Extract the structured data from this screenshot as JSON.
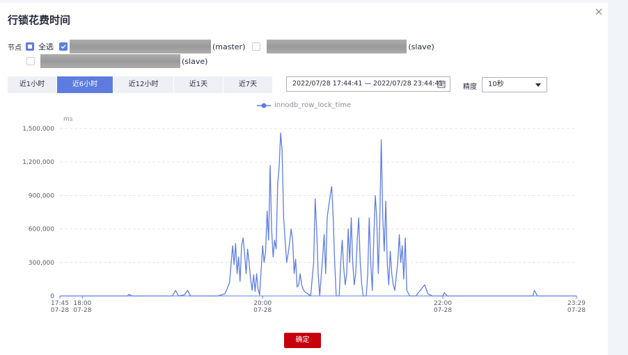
{
  "dialog": {
    "title": "行锁花费时间",
    "close_icon": "close-icon"
  },
  "nodes": {
    "label": "节点",
    "select_all": "全选",
    "items": [
      {
        "role": "(master)",
        "checked": true
      },
      {
        "role": "(slave)",
        "checked": false
      },
      {
        "role": "(slave)",
        "checked": false
      }
    ]
  },
  "time_tabs": [
    {
      "label": "近1小时",
      "active": false
    },
    {
      "label": "近6小时",
      "active": true
    },
    {
      "label": "近12小时",
      "active": false
    },
    {
      "label": "近1天",
      "active": false
    },
    {
      "label": "近7天",
      "active": false
    }
  ],
  "date_range": {
    "value": "2022/07/28 17:44:41 — 2022/07/28 23:44:41",
    "icon": "calendar-icon"
  },
  "precision": {
    "label": "精度",
    "value": "10秒"
  },
  "colors": {
    "accent": "#5e7ce0",
    "confirm": "#c7000b",
    "series": "#5e7ce0"
  },
  "chart_data": {
    "type": "line",
    "ylabel": "ms",
    "ylim": [
      0,
      1500000
    ],
    "yticks": [
      "0",
      "300,000",
      "600,000",
      "900,000",
      "1,200,000",
      "1,500,000"
    ],
    "grid": true,
    "legend_position": "top-center",
    "xticks": [
      {
        "time": "17:45",
        "date": "07-28"
      },
      {
        "time": "18:00",
        "date": "07-28"
      },
      {
        "time": "20:00",
        "date": "07-28"
      },
      {
        "time": "22:00",
        "date": "07-28"
      },
      {
        "time": "23:29",
        "date": "07-28"
      }
    ],
    "series": [
      {
        "name": "innodb_row_lock_time",
        "points": [
          [
            "17:45",
            0
          ],
          [
            "18:15",
            0
          ],
          [
            "18:30",
            0
          ],
          [
            "18:31",
            15000
          ],
          [
            "18:33",
            0
          ],
          [
            "19:00",
            0
          ],
          [
            "19:02",
            50000
          ],
          [
            "19:04",
            0
          ],
          [
            "19:08",
            10000
          ],
          [
            "19:10",
            50000
          ],
          [
            "19:12",
            0
          ],
          [
            "19:30",
            0
          ],
          [
            "19:35",
            20000
          ],
          [
            "19:38",
            120000
          ],
          [
            "19:40",
            450000
          ],
          [
            "19:41",
            280000
          ],
          [
            "19:42",
            470000
          ],
          [
            "19:43",
            200000
          ],
          [
            "19:44",
            350000
          ],
          [
            "19:45",
            130000
          ],
          [
            "19:46",
            450000
          ],
          [
            "19:47",
            520000
          ],
          [
            "19:48",
            380000
          ],
          [
            "19:49",
            200000
          ],
          [
            "19:50",
            420000
          ],
          [
            "19:51",
            300000
          ],
          [
            "19:52",
            150000
          ],
          [
            "19:53",
            50000
          ],
          [
            "19:54",
            190000
          ],
          [
            "19:55",
            40000
          ],
          [
            "19:56",
            200000
          ],
          [
            "19:57",
            60000
          ],
          [
            "19:58",
            10000
          ],
          [
            "20:00",
            450000
          ],
          [
            "20:01",
            300000
          ],
          [
            "20:02",
            400000
          ],
          [
            "20:03",
            760000
          ],
          [
            "20:04",
            500000
          ],
          [
            "20:05",
            1170000
          ],
          [
            "20:06",
            600000
          ],
          [
            "20:07",
            350000
          ],
          [
            "20:08",
            500000
          ],
          [
            "20:09",
            420000
          ],
          [
            "20:10",
            1000000
          ],
          [
            "20:11",
            1150000
          ],
          [
            "20:12",
            1460000
          ],
          [
            "20:13",
            1300000
          ],
          [
            "20:14",
            700000
          ],
          [
            "20:15",
            500000
          ],
          [
            "20:16",
            300000
          ],
          [
            "20:17",
            380000
          ],
          [
            "20:18",
            480000
          ],
          [
            "20:19",
            600000
          ],
          [
            "20:20",
            500000
          ],
          [
            "20:21",
            200000
          ],
          [
            "20:22",
            330000
          ],
          [
            "20:23",
            80000
          ],
          [
            "20:24",
            100000
          ],
          [
            "20:25",
            200000
          ],
          [
            "20:26",
            100000
          ],
          [
            "20:27",
            60000
          ],
          [
            "20:28",
            40000
          ],
          [
            "20:30",
            20000
          ],
          [
            "20:32",
            0
          ],
          [
            "20:34",
            300000
          ],
          [
            "20:35",
            870000
          ],
          [
            "20:36",
            600000
          ],
          [
            "20:37",
            200000
          ],
          [
            "20:38",
            0
          ],
          [
            "20:40",
            350000
          ],
          [
            "20:41",
            550000
          ],
          [
            "20:42",
            200000
          ],
          [
            "20:43",
            700000
          ],
          [
            "20:44",
            800000
          ],
          [
            "20:45",
            900000
          ],
          [
            "20:46",
            980000
          ],
          [
            "20:47",
            700000
          ],
          [
            "20:48",
            300000
          ],
          [
            "20:49",
            0
          ],
          [
            "20:51",
            0
          ],
          [
            "20:52",
            300000
          ],
          [
            "20:53",
            500000
          ],
          [
            "20:54",
            250000
          ],
          [
            "20:55",
            100000
          ],
          [
            "20:56",
            200000
          ],
          [
            "20:57",
            600000
          ],
          [
            "20:58",
            300000
          ],
          [
            "20:59",
            700000
          ],
          [
            "21:00",
            300000
          ],
          [
            "21:01",
            100000
          ],
          [
            "21:02",
            200000
          ],
          [
            "21:03",
            500000
          ],
          [
            "21:04",
            700000
          ],
          [
            "21:05",
            300000
          ],
          [
            "21:06",
            100000
          ],
          [
            "21:07",
            0
          ],
          [
            "21:09",
            0
          ],
          [
            "21:10",
            200000
          ],
          [
            "21:11",
            700000
          ],
          [
            "21:12",
            300000
          ],
          [
            "21:13",
            50000
          ],
          [
            "21:14",
            500000
          ],
          [
            "21:15",
            900000
          ],
          [
            "21:16",
            700000
          ],
          [
            "21:17",
            200000
          ],
          [
            "21:18",
            650000
          ],
          [
            "21:19",
            1400000
          ],
          [
            "21:20",
            700000
          ],
          [
            "21:21",
            400000
          ],
          [
            "21:22",
            850000
          ],
          [
            "21:23",
            300000
          ],
          [
            "21:24",
            100000
          ],
          [
            "21:25",
            400000
          ],
          [
            "21:26",
            200000
          ],
          [
            "21:27",
            100000
          ],
          [
            "21:28",
            50000
          ],
          [
            "21:30",
            300000
          ],
          [
            "21:31",
            550000
          ],
          [
            "21:32",
            300000
          ],
          [
            "21:33",
            450000
          ],
          [
            "21:34",
            150000
          ],
          [
            "21:35",
            520000
          ],
          [
            "21:36",
            50000
          ],
          [
            "21:38",
            0
          ],
          [
            "21:40",
            0
          ],
          [
            "21:42",
            0
          ],
          [
            "21:48",
            100000
          ],
          [
            "21:50",
            20000
          ],
          [
            "21:53",
            0
          ],
          [
            "22:00",
            0
          ],
          [
            "22:01",
            30000
          ],
          [
            "22:03",
            0
          ],
          [
            "23:00",
            0
          ],
          [
            "23:01",
            50000
          ],
          [
            "23:03",
            0
          ],
          [
            "23:29",
            0
          ]
        ]
      }
    ]
  },
  "footer": {
    "confirm_label": "确定"
  }
}
